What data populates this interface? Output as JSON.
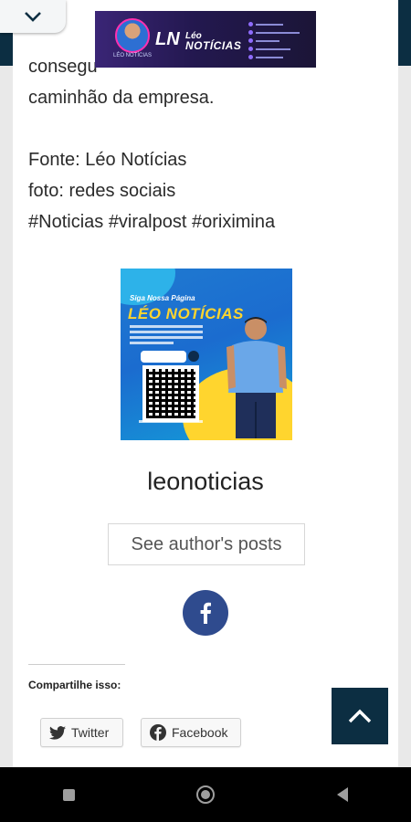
{
  "header": {
    "logo": {
      "caption": "LÉO NOTÍCIAS",
      "mark": "LN",
      "title_line1": "Léo",
      "title_line2": "NOTÍCIAS"
    },
    "colors": {
      "bar": "#0c2e42",
      "accent": "#ff2fb0"
    }
  },
  "article": {
    "text_fragment": "consegu",
    "text_line": "caminhão da empresa.",
    "source": "Fonte: Léo Notícias",
    "photo_credit": "foto: redes sociais",
    "hashtags": "#Noticias #viralpost #oriximina"
  },
  "author": {
    "image": {
      "headline": "Siga Nossa Página",
      "brand": "LÉO NOTÍCIAS"
    },
    "name": "leonoticias",
    "posts_button": "See author's posts",
    "social_icon": "facebook-icon"
  },
  "share": {
    "heading": "Compartilhe isso:",
    "twitter_label": "Twitter",
    "facebook_label": "Facebook"
  },
  "icons": {
    "collapse": "chevron-down-icon",
    "menu": "hamburger-icon",
    "search": "search-icon",
    "back_to_top": "chevron-up-icon"
  }
}
